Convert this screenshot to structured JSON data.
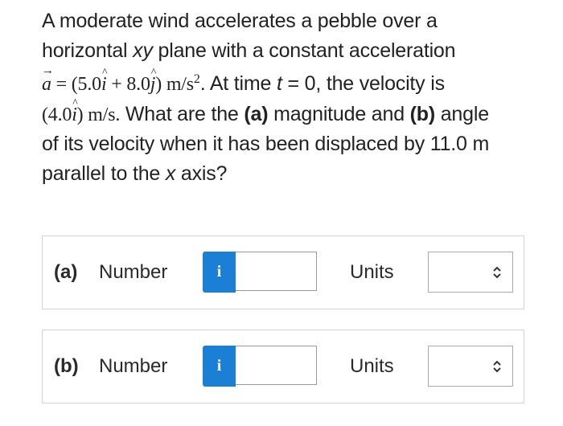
{
  "question": {
    "line1": "A moderate wind accelerates a pebble over a",
    "line2_pre": "horizontal ",
    "line2_var": "xy",
    "line2_post": " plane with a constant acceleration",
    "accel_symbol": "a",
    "accel_eq_pre": " = (5.0",
    "i_symbol": "i",
    "accel_eq_mid": " + 8.0",
    "j_symbol": "j",
    "accel_eq_post": ") m/s",
    "accel_exp": "2",
    "line3_text_pre": ". At time ",
    "t_var": "t",
    "line3_text_post": " = 0, the velocity is",
    "vel_eq_pre": "(4.0",
    "vel_eq_post": ") m/s.",
    "line4_text_a": " What are the ",
    "part_a_bold": "(a)",
    "line4_text_b": " magnitude and ",
    "part_b_bold": "(b)",
    "line4_text_c": " angle",
    "line5": "of its velocity when it has been displaced by 11.0 m",
    "line6_pre": "parallel to the ",
    "x_var": "x",
    "line6_post": " axis?"
  },
  "answers": [
    {
      "part": "(a)",
      "number_label": "Number",
      "info_label": "i",
      "number_value": "",
      "units_label": "Units",
      "units_value": "",
      "units_icon": "chevron-up-down-icon"
    },
    {
      "part": "(b)",
      "number_label": "Number",
      "info_label": "i",
      "number_value": "",
      "units_label": "Units",
      "units_value": "",
      "units_icon": "chevron-up-down-icon"
    }
  ],
  "colors": {
    "info_button": "#1c7fd6",
    "text": "#222222",
    "border": "#d4d4d4"
  }
}
